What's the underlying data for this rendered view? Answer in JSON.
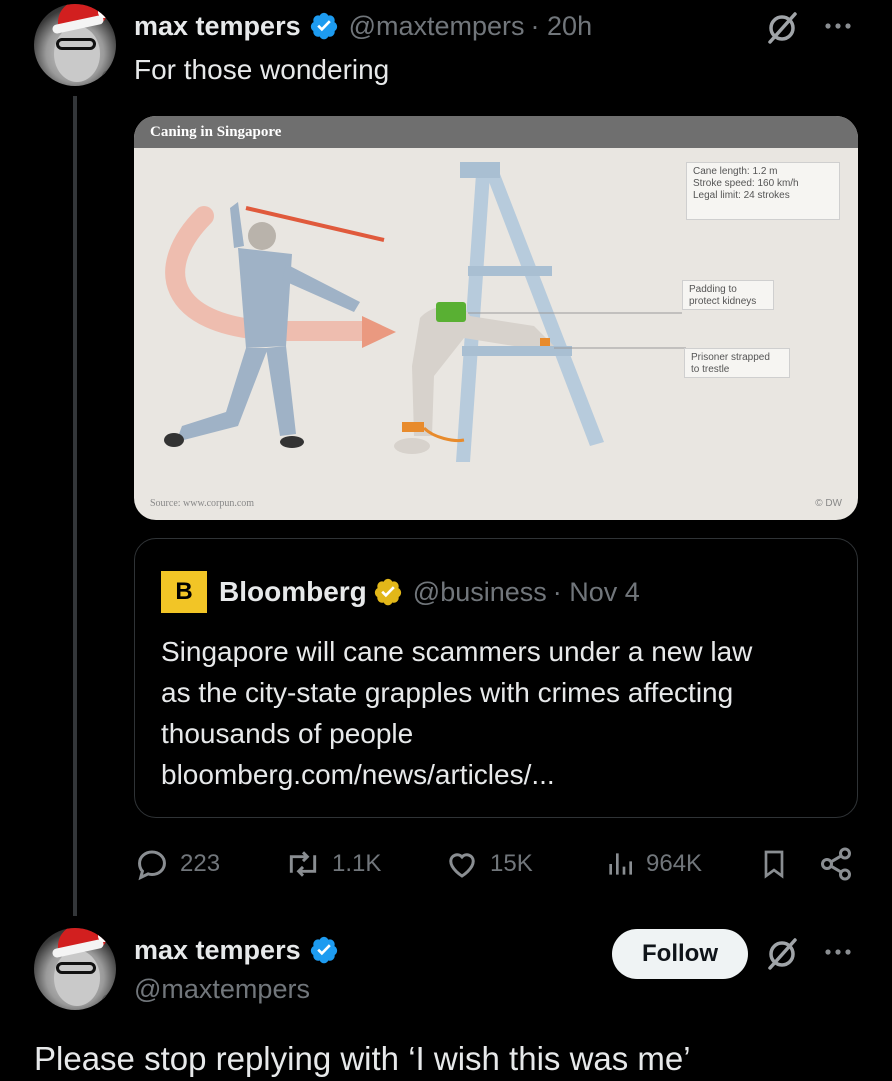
{
  "post": {
    "author_name": "max tempers",
    "handle": "@maxtempers",
    "time": "· 20h",
    "text": "For those wondering"
  },
  "media": {
    "title": "Caning in Singapore",
    "stats": [
      "Cane length: 1.2 m",
      "Stroke speed: 160 km/h",
      "Legal limit: 24 strokes"
    ],
    "callout_padding": [
      "Padding to",
      "protect kidneys"
    ],
    "callout_prisoner": [
      "Prisoner strapped",
      "to trestle"
    ],
    "source": "Source: www.corpun.com",
    "credit": "© DW"
  },
  "quoted": {
    "logo_letter": "B",
    "author_name": "Bloomberg",
    "handle": "@business",
    "time": "· Nov 4",
    "text_lines": [
      "Singapore will cane scammers under a new law",
      "as the city-state grapples with crimes affecting",
      "thousands of people",
      "bloomberg.com/news/articles/..."
    ]
  },
  "actions": {
    "replies": "223",
    "reposts": "1.1K",
    "likes": "15K",
    "views": "964K"
  },
  "reply": {
    "author_name": "max tempers",
    "handle": "@maxtempers",
    "follow_label": "Follow",
    "text": "Please stop replying with ‘I wish this was me’"
  },
  "colors": {
    "background": "#000000",
    "verified_blue": "#1d9bf0",
    "verified_gold": "#e2b719",
    "muted": "#71767b"
  },
  "icons": [
    "verified-icon",
    "grok-icon",
    "more-icon",
    "reply-icon",
    "repost-icon",
    "like-icon",
    "views-icon",
    "bookmark-icon",
    "share-icon"
  ]
}
